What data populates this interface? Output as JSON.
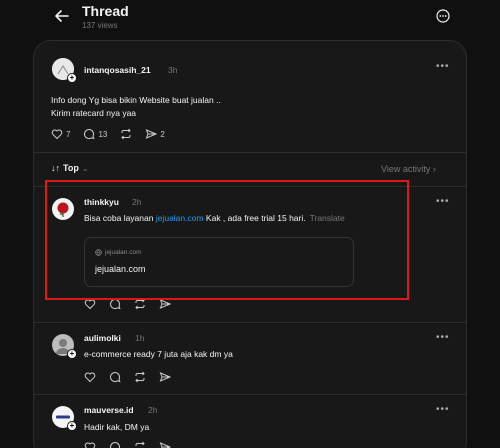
{
  "header": {
    "title": "Thread",
    "views": "137 views",
    "back_icon": "arrow-left-icon",
    "more_icon": "more-circle-icon"
  },
  "original_post": {
    "username": "intanqosasih_21",
    "time": "3h",
    "line1": "Info dong Yg bisa bikin Website buat jualan ..",
    "line2": "Kirim ratecard nya yaa",
    "likes": "7",
    "replies": "13",
    "shares": "2"
  },
  "sort": {
    "label": "Top",
    "view_activity": "View activity"
  },
  "replies": [
    {
      "username": "thinkkyu",
      "time": "2h",
      "text_before": "Bisa coba layanan ",
      "link": "jejualan.com",
      "text_after": " Kak , ada free trial 15 hari.",
      "translate": "Translate",
      "preview_domain": "jejualan.com",
      "preview_title": "jejualan.com"
    },
    {
      "username": "aulimolki",
      "time": "1h",
      "text": "e-commerce ready 7 juta aja kak dm ya"
    },
    {
      "username": "mauverse.id",
      "time": "2h",
      "text": "Hadir kak, DM ya"
    }
  ],
  "colors": {
    "accent_link": "#1d9bf0",
    "highlight": "#e0161c",
    "background": "#101010",
    "card": "#181818"
  }
}
